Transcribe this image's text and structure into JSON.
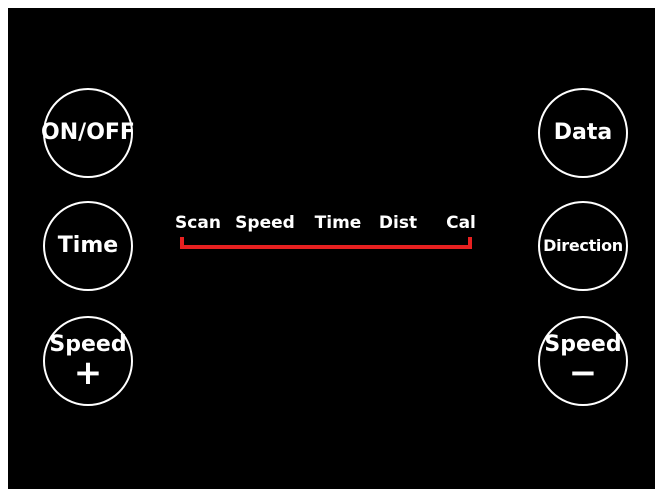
{
  "colors": {
    "panel_background": "#000000",
    "button_outline": "#ffffff",
    "text": "#ffffff",
    "indicator_bracket": "#e82020"
  },
  "left_buttons": {
    "onoff_label": "ON/OFF",
    "time_label": "Time",
    "speed_up_label": "Speed",
    "speed_up_symbol": "+"
  },
  "right_buttons": {
    "data_label": "Data",
    "direction_label": "Direction",
    "speed_down_label": "Speed",
    "speed_down_symbol": "−"
  },
  "display": {
    "modes": [
      "Scan",
      "Speed",
      "Time",
      "Dist",
      "Cal"
    ]
  }
}
